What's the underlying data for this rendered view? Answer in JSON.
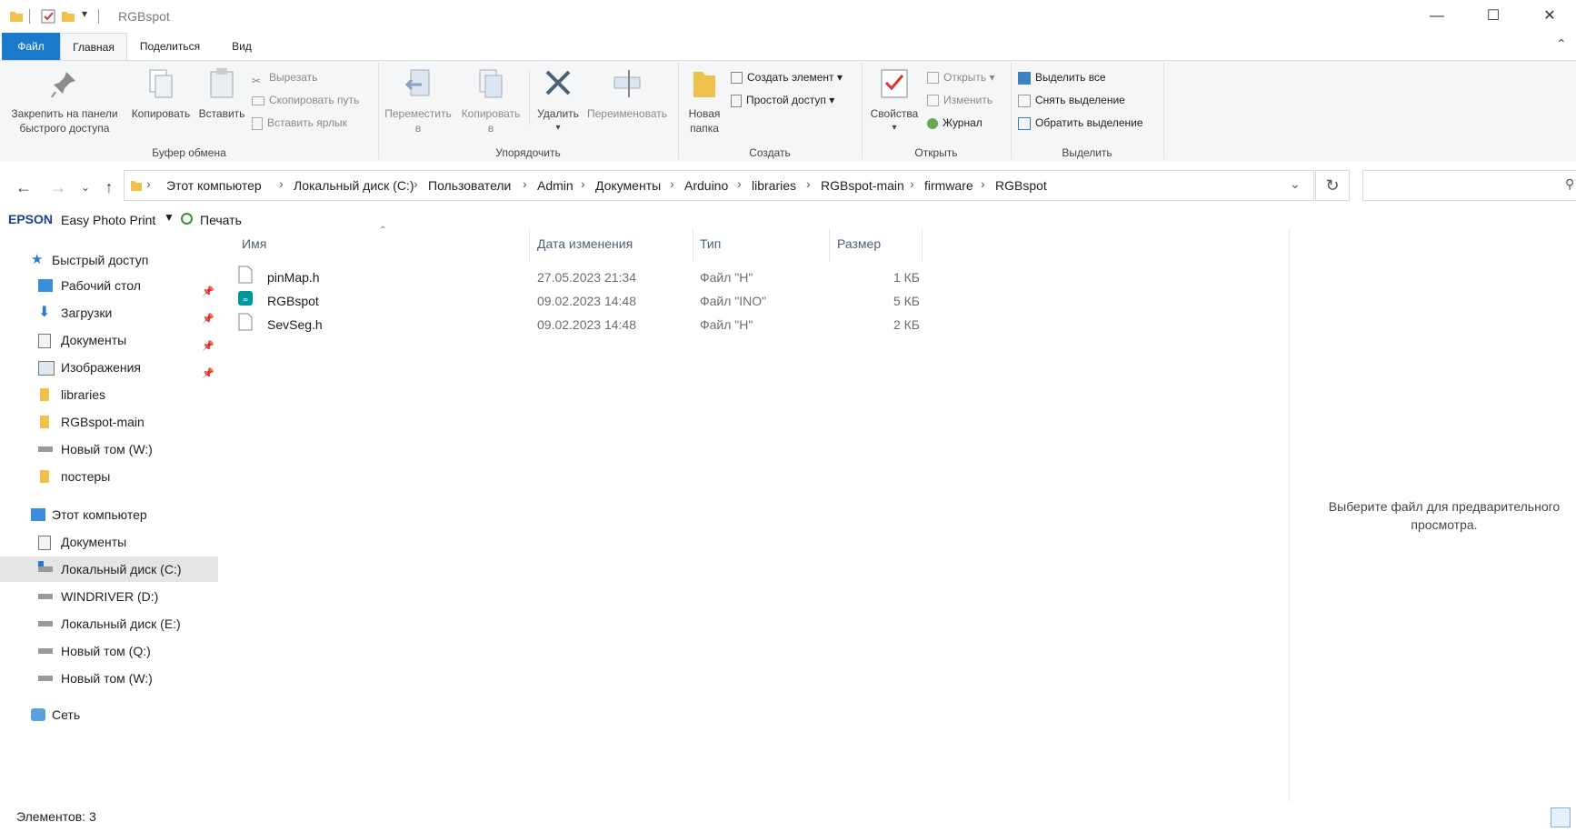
{
  "window": {
    "title": "RGBspot",
    "controls": [
      "minimize",
      "maximize",
      "close"
    ]
  },
  "ribbon_tabs": [
    {
      "label": "Файл"
    },
    {
      "label": "Главная"
    },
    {
      "label": "Поделиться"
    },
    {
      "label": "Вид"
    }
  ],
  "ribbon": {
    "clipboard": {
      "pin_label_1": "Закрепить на панели",
      "pin_label_2": "быстрого доступа",
      "copy": "Копировать",
      "paste": "Вставить",
      "cut": "Вырезать",
      "copy_path": "Скопировать путь",
      "paste_shortcut": "Вставить ярлык",
      "group_label": "Буфер обмена"
    },
    "organize": {
      "move_1": "Переместить",
      "move_2": "в",
      "copyto_1": "Копировать",
      "copyto_2": "в",
      "delete": "Удалить",
      "rename": "Переименовать",
      "group_label": "Упорядочить"
    },
    "new": {
      "new_folder_1": "Новая",
      "new_folder_2": "папка",
      "new_item": "Создать элемент",
      "easy_access": "Простой доступ",
      "group_label": "Создать"
    },
    "open": {
      "properties": "Свойства",
      "open": "Открыть",
      "edit": "Изменить",
      "history": "Журнал",
      "group_label": "Открыть"
    },
    "select": {
      "select_all": "Выделить все",
      "select_none": "Снять выделение",
      "invert": "Обратить выделение",
      "group_label": "Выделить"
    }
  },
  "address": {
    "crumbs": [
      "Этот компьютер",
      "Локальный диск (C:)",
      "Пользователи",
      "Admin",
      "Документы",
      "Arduino",
      "libraries",
      "RGBspot-main",
      "firmware",
      "RGBspot"
    ]
  },
  "epson": {
    "brand": "EPSON",
    "app": "Easy Photo Print",
    "print": "Печать"
  },
  "sidebar": {
    "quick_access": "Быстрый доступ",
    "quick_items": [
      {
        "label": "Рабочий стол",
        "icon": "desktop-icon",
        "pinned": true
      },
      {
        "label": "Загрузки",
        "icon": "downloads-icon",
        "pinned": true
      },
      {
        "label": "Документы",
        "icon": "documents-icon",
        "pinned": true
      },
      {
        "label": "Изображения",
        "icon": "pictures-icon",
        "pinned": true
      },
      {
        "label": "libraries",
        "icon": "folder-icon",
        "pinned": false
      },
      {
        "label": "RGBspot-main",
        "icon": "folder-icon",
        "pinned": false
      },
      {
        "label": "Новый том (W:)",
        "icon": "drive-icon",
        "pinned": false
      },
      {
        "label": "постеры",
        "icon": "folder-icon",
        "pinned": false
      }
    ],
    "this_pc": "Этот компьютер",
    "pc_items": [
      {
        "label": "Документы",
        "icon": "documents-icon"
      },
      {
        "label": "Локальный диск (C:)",
        "icon": "windows-drive-icon",
        "selected": true
      },
      {
        "label": "WINDRIVER (D:)",
        "icon": "drive-icon"
      },
      {
        "label": "Локальный диск (E:)",
        "icon": "drive-icon"
      },
      {
        "label": "Новый том (Q:)",
        "icon": "drive-icon"
      },
      {
        "label": "Новый том (W:)",
        "icon": "drive-icon"
      }
    ],
    "network": "Сеть"
  },
  "columns": {
    "name": "Имя",
    "date": "Дата изменения",
    "type": "Тип",
    "size": "Размер"
  },
  "files": [
    {
      "name": "pinMap.h",
      "date": "27.05.2023 21:34",
      "type": "Файл \"H\"",
      "size": "1 КБ",
      "icon": "file-icon"
    },
    {
      "name": "RGBspot",
      "date": "09.02.2023 14:48",
      "type": "Файл \"INO\"",
      "size": "5 КБ",
      "icon": "arduino-icon"
    },
    {
      "name": "SevSeg.h",
      "date": "09.02.2023 14:48",
      "type": "Файл \"H\"",
      "size": "2 КБ",
      "icon": "file-icon"
    }
  ],
  "preview": {
    "line1": "Выберите файл для предварительного",
    "line2": "просмотра."
  },
  "status": {
    "items": "Элементов: 3"
  },
  "colors": {
    "accent": "#1979ca",
    "folder": "#f0c24b",
    "selected": "#e5e5e5"
  }
}
